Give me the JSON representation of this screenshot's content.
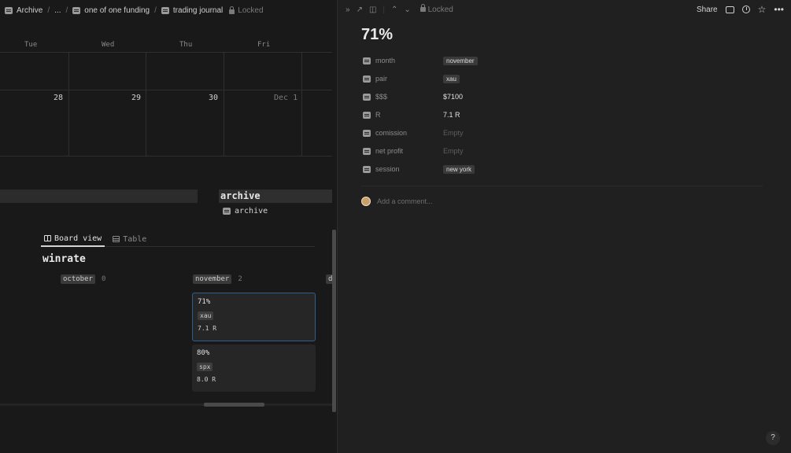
{
  "breadcrumb": {
    "items": [
      "Archive",
      "...",
      "one of one funding",
      "trading journal"
    ],
    "locked_label": "Locked"
  },
  "calendar": {
    "days": [
      "Tue",
      "Wed",
      "Thu",
      "Fri"
    ],
    "dates": [
      "28",
      "29",
      "30",
      "Dec 1"
    ]
  },
  "archive": {
    "heading": "archive",
    "link_label": "archive"
  },
  "tabs": [
    {
      "label": "Board view",
      "active": true
    },
    {
      "label": "Table",
      "active": false
    }
  ],
  "board": {
    "title": "winrate",
    "groups": [
      {
        "label": "october",
        "count": "0"
      },
      {
        "label": "november",
        "count": "2"
      },
      {
        "label": "d"
      }
    ],
    "cards": [
      {
        "title": "71%",
        "pair": "xau",
        "r": "7.1 R",
        "selected": true
      },
      {
        "title": "80%",
        "pair": "spx",
        "r": "8.0 R",
        "selected": false
      }
    ]
  },
  "peek": {
    "locked_label": "Locked",
    "share_label": "Share",
    "title": "71%",
    "properties": [
      {
        "label": "month",
        "value": "november",
        "kind": "tag"
      },
      {
        "label": "pair",
        "value": "xau",
        "kind": "tag"
      },
      {
        "label": "$$$",
        "value": "$7100",
        "kind": "text"
      },
      {
        "label": "R",
        "value": "7.1 R",
        "kind": "text"
      },
      {
        "label": "comission",
        "value": "Empty",
        "kind": "empty"
      },
      {
        "label": "net profit",
        "value": "Empty",
        "kind": "empty"
      },
      {
        "label": "session",
        "value": "new york",
        "kind": "tag"
      }
    ],
    "comment_placeholder": "Add a comment..."
  },
  "help_label": "?"
}
